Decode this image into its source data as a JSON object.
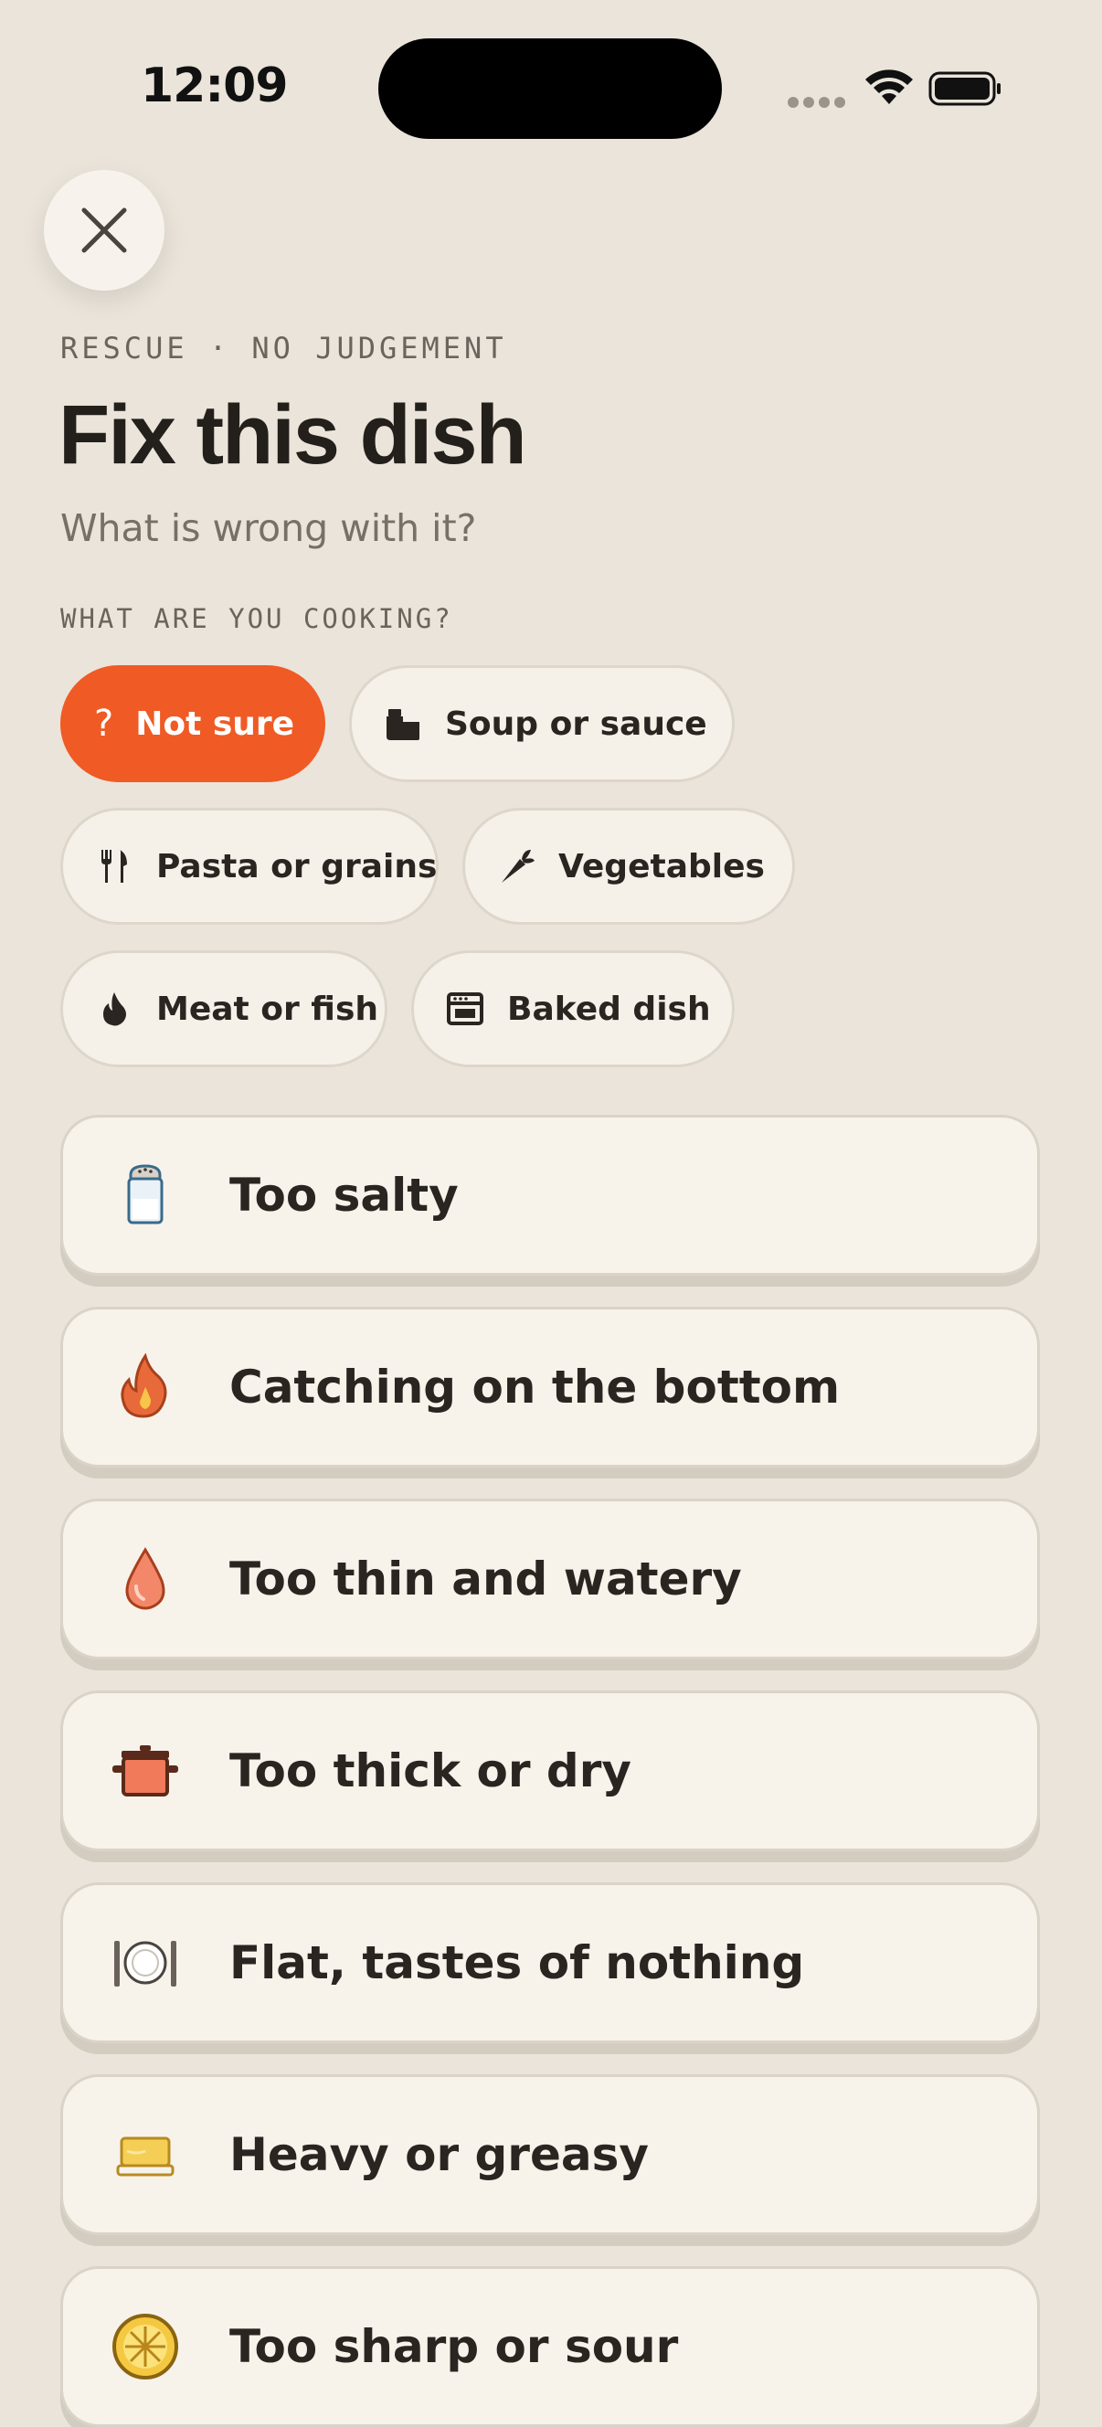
{
  "status": {
    "time": "12:09"
  },
  "header": {
    "eyebrow": "RESCUE · NO JUDGEMENT",
    "title": "Fix this dish",
    "subtitle": "What is wrong with it?"
  },
  "dish_type": {
    "label": "WHAT ARE YOU COOKING?",
    "selected": "Not sure",
    "chips": [
      {
        "label": "Not sure",
        "icon": "question-icon"
      },
      {
        "label": "Soup or sauce",
        "icon": "pot-icon"
      },
      {
        "label": "Pasta or grains",
        "icon": "fork-knife-icon"
      },
      {
        "label": "Vegetables",
        "icon": "carrot-icon"
      },
      {
        "label": "Meat or fish",
        "icon": "flame-icon"
      },
      {
        "label": "Baked dish",
        "icon": "oven-icon"
      }
    ]
  },
  "problems": [
    {
      "label": "Too salty",
      "icon": "salt-shaker-icon"
    },
    {
      "label": "Catching on the bottom",
      "icon": "fire-icon"
    },
    {
      "label": "Too thin and watery",
      "icon": "droplet-icon"
    },
    {
      "label": "Too thick or dry",
      "icon": "cooking-pot-icon"
    },
    {
      "label": "Flat, tastes of nothing",
      "icon": "plate-cutlery-icon"
    },
    {
      "label": "Heavy or greasy",
      "icon": "butter-icon"
    },
    {
      "label": "Too sharp or sour",
      "icon": "lemon-icon"
    }
  ],
  "colors": {
    "background": "#EAE4DA",
    "accent": "#F05A24",
    "card": "#F7F3EB",
    "text": "#2A2520"
  }
}
